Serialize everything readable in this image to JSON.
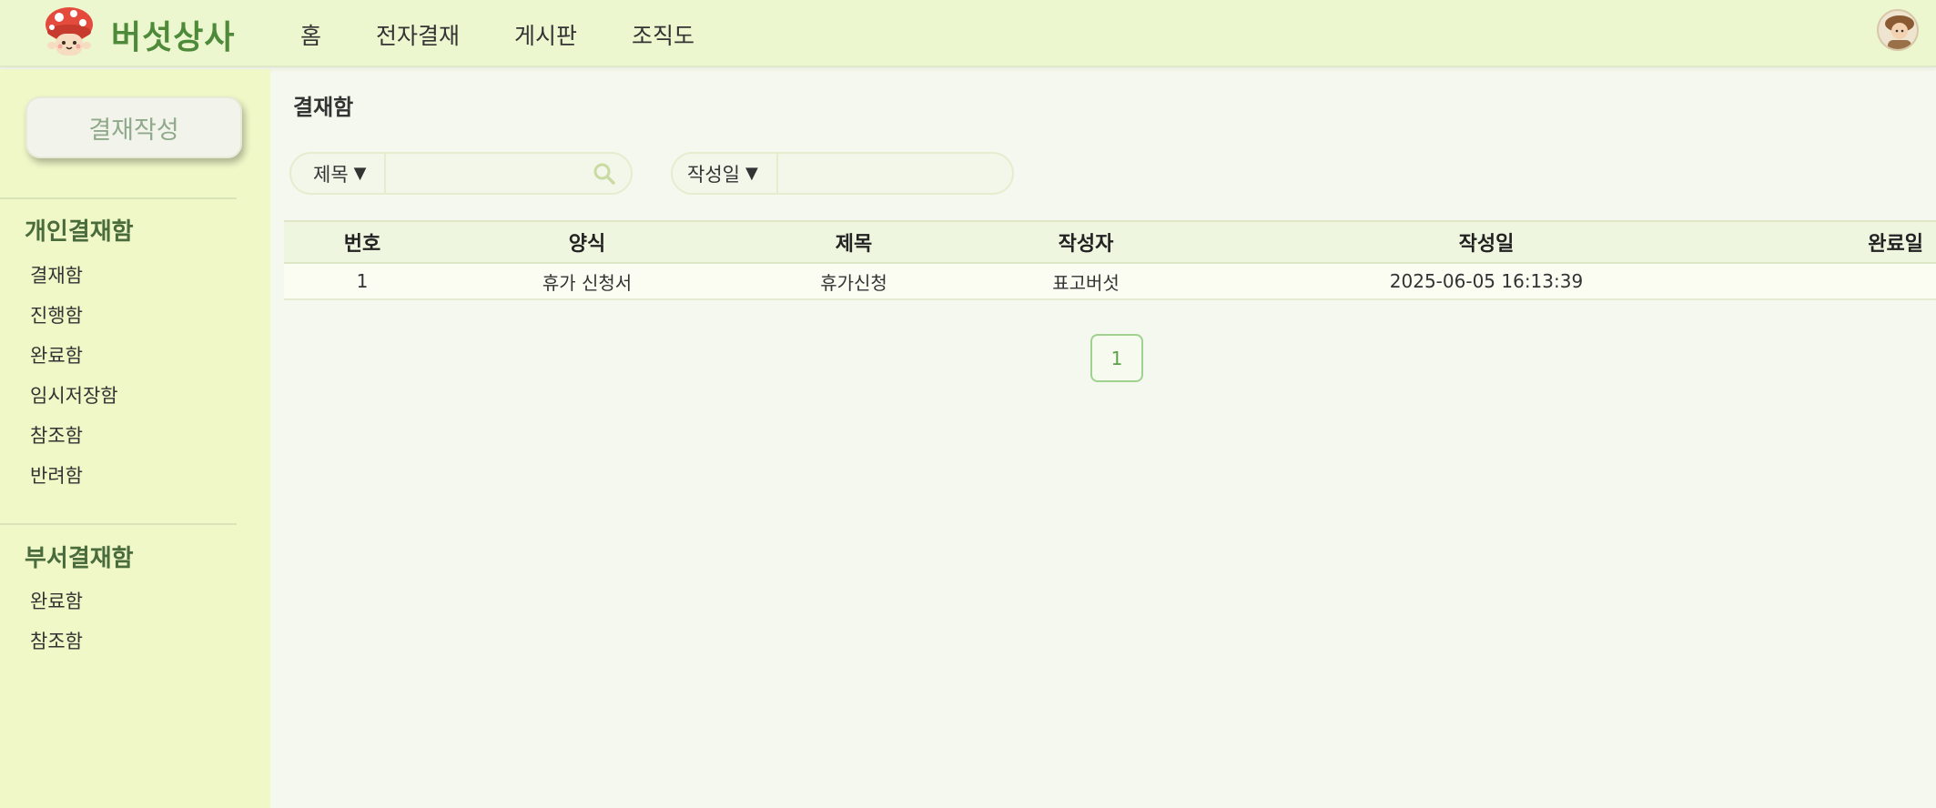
{
  "header": {
    "logo_icon": "mushroom-logo-icon",
    "brand": "버섯상사",
    "nav": [
      {
        "label": "홈"
      },
      {
        "label": "전자결재"
      },
      {
        "label": "게시판"
      },
      {
        "label": "조직도"
      }
    ],
    "avatar_icon": "user-avatar-icon"
  },
  "sidebar": {
    "write_button": "결재작성",
    "personal_title": "개인결재함",
    "personal_items": [
      "결재함",
      "진행함",
      "완료함",
      "임시저장함",
      "참조함",
      "반려함"
    ],
    "dept_title": "부서결재함",
    "dept_items": [
      "완료함",
      "참조함"
    ]
  },
  "main": {
    "title": "결재함",
    "search1": {
      "select": "제목",
      "arrow": "▼",
      "value": ""
    },
    "search2": {
      "select": "작성일",
      "arrow": "▼",
      "value": ""
    },
    "table": {
      "headers": [
        "번호",
        "양식",
        "제목",
        "작성자",
        "작성일",
        "완료일"
      ],
      "rows": [
        [
          "1",
          "휴가 신청서",
          "휴가신청",
          "표고버섯",
          "2025-06-05 16:13:39",
          ""
        ]
      ]
    },
    "pagination": {
      "current": "1"
    }
  },
  "colors": {
    "header_bg": "#ecf7d0",
    "sidebar_bg": "#f0f8c8",
    "brand": "#4f8a3a",
    "section_title": "#4a6b3c",
    "page_bg": "#f5f8ee",
    "pager_accent": "#5aa046"
  }
}
